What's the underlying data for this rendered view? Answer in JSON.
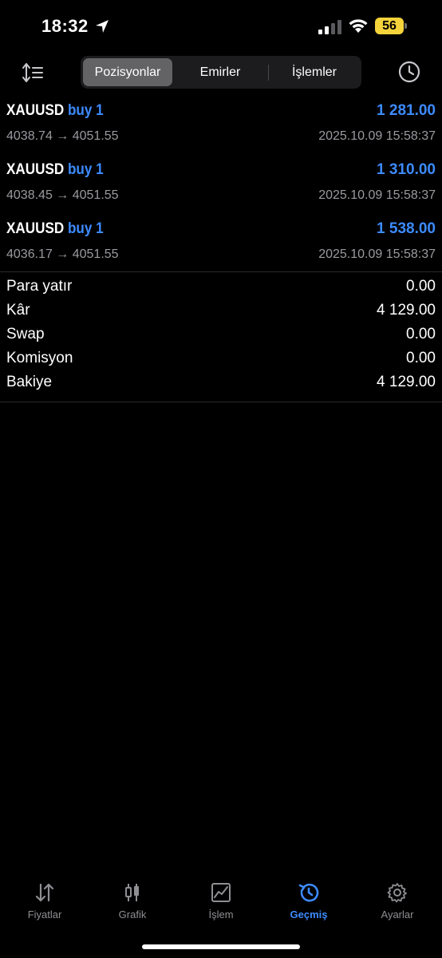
{
  "status_bar": {
    "time": "18:32",
    "battery": "56"
  },
  "toolbar": {
    "segments": [
      "Pozisyonlar",
      "Emirler",
      "İşlemler"
    ],
    "active_segment": 0
  },
  "positions": [
    {
      "symbol": "XAUUSD",
      "side": "buy 1",
      "profit": "1 281.00",
      "prices": "4038.74 → 4051.55",
      "time": "2025.10.09 15:58:37"
    },
    {
      "symbol": "XAUUSD",
      "side": "buy 1",
      "profit": "1 310.00",
      "prices": "4038.45 → 4051.55",
      "time": "2025.10.09 15:58:37"
    },
    {
      "symbol": "XAUUSD",
      "side": "buy 1",
      "profit": "1 538.00",
      "prices": "4036.17 → 4051.55",
      "time": "2025.10.09 15:58:37"
    }
  ],
  "summary": [
    {
      "label": "Para yatır",
      "value": "0.00"
    },
    {
      "label": "Kâr",
      "value": "4 129.00"
    },
    {
      "label": "Swap",
      "value": "0.00"
    },
    {
      "label": "Komisyon",
      "value": "0.00"
    },
    {
      "label": "Bakiye",
      "value": "4 129.00"
    }
  ],
  "tabs": [
    {
      "label": "Fiyatlar",
      "icon": "quotes-icon"
    },
    {
      "label": "Grafik",
      "icon": "chart-icon"
    },
    {
      "label": "İşlem",
      "icon": "trade-icon"
    },
    {
      "label": "Geçmiş",
      "icon": "history-icon"
    },
    {
      "label": "Ayarlar",
      "icon": "settings-icon"
    }
  ],
  "active_tab": 3,
  "colors": {
    "accent": "#3d8bff",
    "background": "#000000",
    "muted": "#9a9aa0",
    "battery": "#f5d33b"
  }
}
